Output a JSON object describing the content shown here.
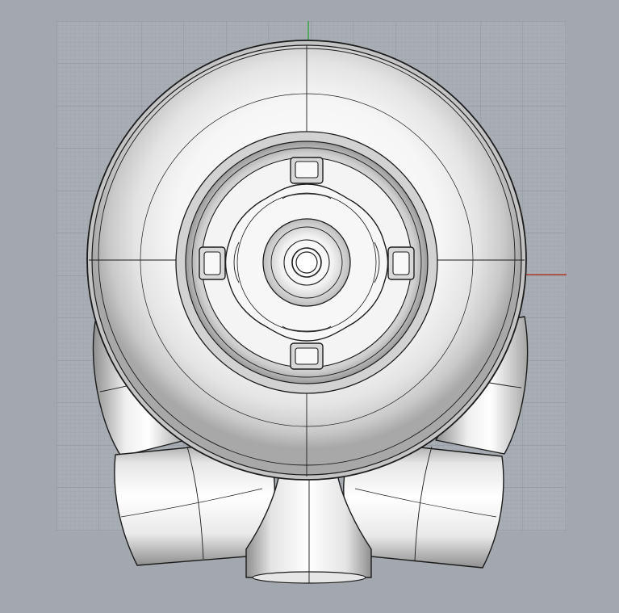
{
  "viewport": {
    "view": "top",
    "display_mode": "shaded",
    "grid_visible": true,
    "axes_visible": true
  },
  "colors": {
    "viewport_background": "#a3a8ae",
    "grid_background": "#a9aeb4",
    "grid_minor_line": "#9aa0a7",
    "grid_major_line": "#8c939b",
    "x_axis": "#b03a2e",
    "y_axis": "#3aa64a",
    "model_edge": "#1c1c1c",
    "model_light": "#fbfbfb",
    "model_shadow": "#8e8e8e"
  },
  "model": {
    "name": "pump-housing",
    "wall_fixture_tabs": 4
  }
}
